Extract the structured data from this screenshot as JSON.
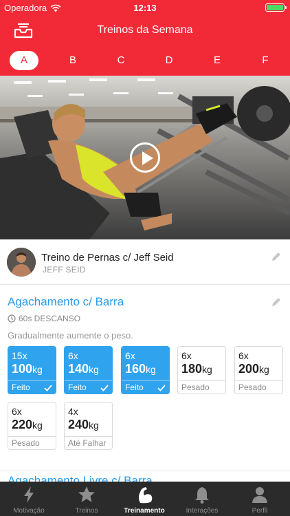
{
  "status_bar": {
    "carrier": "Operadora",
    "time": "12:13"
  },
  "nav": {
    "title": "Treinos da Semana",
    "left_icon": "tray-icon"
  },
  "tabs": [
    {
      "label": "A",
      "active": true
    },
    {
      "label": "B",
      "active": false
    },
    {
      "label": "C",
      "active": false
    },
    {
      "label": "D",
      "active": false
    },
    {
      "label": "E",
      "active": false
    },
    {
      "label": "F",
      "active": false
    }
  ],
  "video": {
    "play_icon": "play-icon"
  },
  "workout": {
    "title": "Treino de Pernas c/ Jeff Seid",
    "author": "JEFF SEID",
    "edit_icon": "pencil-icon"
  },
  "exercise": {
    "title": "Agachamento c/ Barra",
    "rest": "60s DESCANSO",
    "note": "Gradualmente aumente o peso.",
    "sets": [
      {
        "reps": "15x",
        "weight": "100",
        "unit": "kg",
        "status": "Feito",
        "done": true
      },
      {
        "reps": "6x",
        "weight": "140",
        "unit": "kg",
        "status": "Feito",
        "done": true
      },
      {
        "reps": "6x",
        "weight": "160",
        "unit": "kg",
        "status": "Feito",
        "done": true
      },
      {
        "reps": "6x",
        "weight": "180",
        "unit": "kg",
        "status": "Pesado",
        "done": false
      },
      {
        "reps": "6x",
        "weight": "200",
        "unit": "kg",
        "status": "Pesado",
        "done": false
      },
      {
        "reps": "6x",
        "weight": "220",
        "unit": "kg",
        "status": "Pesado",
        "done": false
      },
      {
        "reps": "4x",
        "weight": "240",
        "unit": "kg",
        "status": "Até Falhar",
        "done": false
      }
    ]
  },
  "next_exercise": {
    "title": "Agachamento Livre c/ Barra"
  },
  "tabbar": [
    {
      "label": "Motivação",
      "icon": "lightning-icon",
      "active": false
    },
    {
      "label": "Treinos",
      "icon": "star-icon",
      "active": false
    },
    {
      "label": "Treinamento",
      "icon": "flexed-arm-icon",
      "active": true
    },
    {
      "label": "Interações",
      "icon": "bell-icon",
      "active": false
    },
    {
      "label": "Perfil",
      "icon": "person-icon",
      "active": false
    }
  ],
  "colors": {
    "brand_red": "#f22a38",
    "accent_blue": "#2fa3ee",
    "tabbar_bg": "#2b2b2b"
  }
}
